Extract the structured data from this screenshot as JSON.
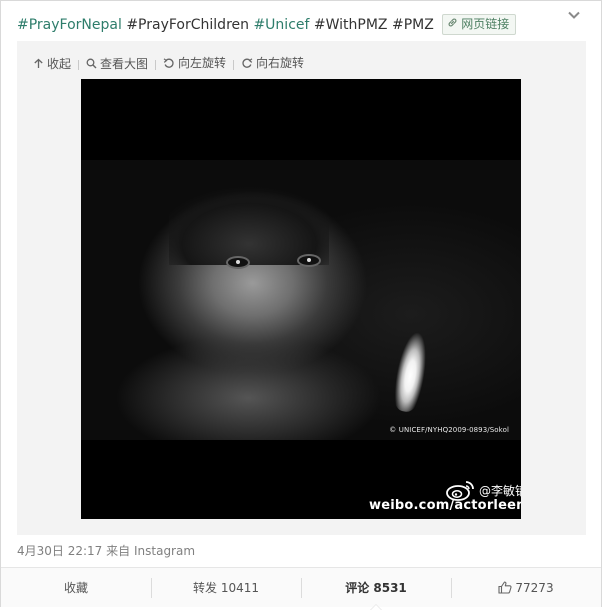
{
  "post": {
    "hashtags": [
      {
        "text": "#PrayForNepal",
        "style": "green"
      },
      {
        "text": "#PrayForChildren",
        "style": "dark"
      },
      {
        "text": "#Unicef",
        "style": "green"
      },
      {
        "text": "#WithPMZ",
        "style": "dark"
      },
      {
        "text": "#PMZ",
        "style": "dark"
      }
    ],
    "web_link_label": "网页链接",
    "more_icon": "chevron-down-icon"
  },
  "media": {
    "tools": [
      {
        "label": "收起",
        "icon": "collapse-up-icon"
      },
      {
        "label": "查看大图",
        "icon": "search-icon"
      },
      {
        "label": "向左旋转",
        "icon": "rotate-left-icon"
      },
      {
        "label": "向右旋转",
        "icon": "rotate-right-icon"
      }
    ],
    "photo_credit": "© UNICEF/NYHQ2009-0893/Sokol",
    "watermark_handle": "@李敏镐",
    "watermark_url": "weibo.com/actorleeminho"
  },
  "meta": {
    "time": "4月30日 22:17",
    "source_prefix": "来自",
    "source": "Instagram"
  },
  "actions": {
    "favorite": "收藏",
    "repost": "转发 10411",
    "comment": "评论 8531",
    "like": "77273"
  },
  "colors": {
    "hashtag_green": "#2e7d6b",
    "background_panel": "#f3f3f3"
  }
}
